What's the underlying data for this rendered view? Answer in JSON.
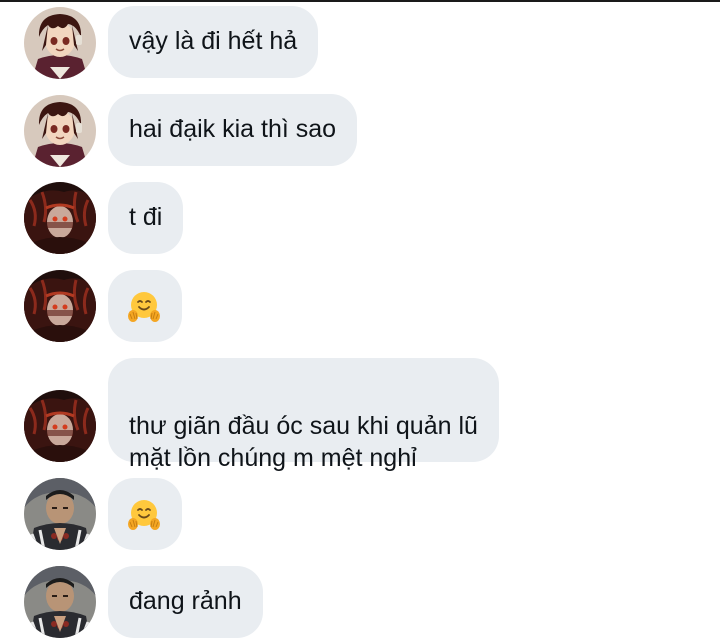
{
  "messages": [
    {
      "sender": "tanjiro",
      "text": "vậy là đi hết hả"
    },
    {
      "sender": "tanjiro",
      "text": "hai đạik kia thì sao"
    },
    {
      "sender": "kokushibo",
      "text": "t đi"
    },
    {
      "sender": "kokushibo",
      "emoji": "hugging-face"
    },
    {
      "sender": "kokushibo",
      "text": "thư giãn đầu óc sau khi quản lũ\nmặt lồn chúng m mệt nghỉ"
    },
    {
      "sender": "gyomei",
      "emoji": "hugging-face"
    },
    {
      "sender": "gyomei",
      "text": "đang rảnh"
    }
  ],
  "colors": {
    "bubble_bg": "#e9edf1",
    "text": "#0f1419",
    "emoji_yellow": "#ffc83d"
  }
}
